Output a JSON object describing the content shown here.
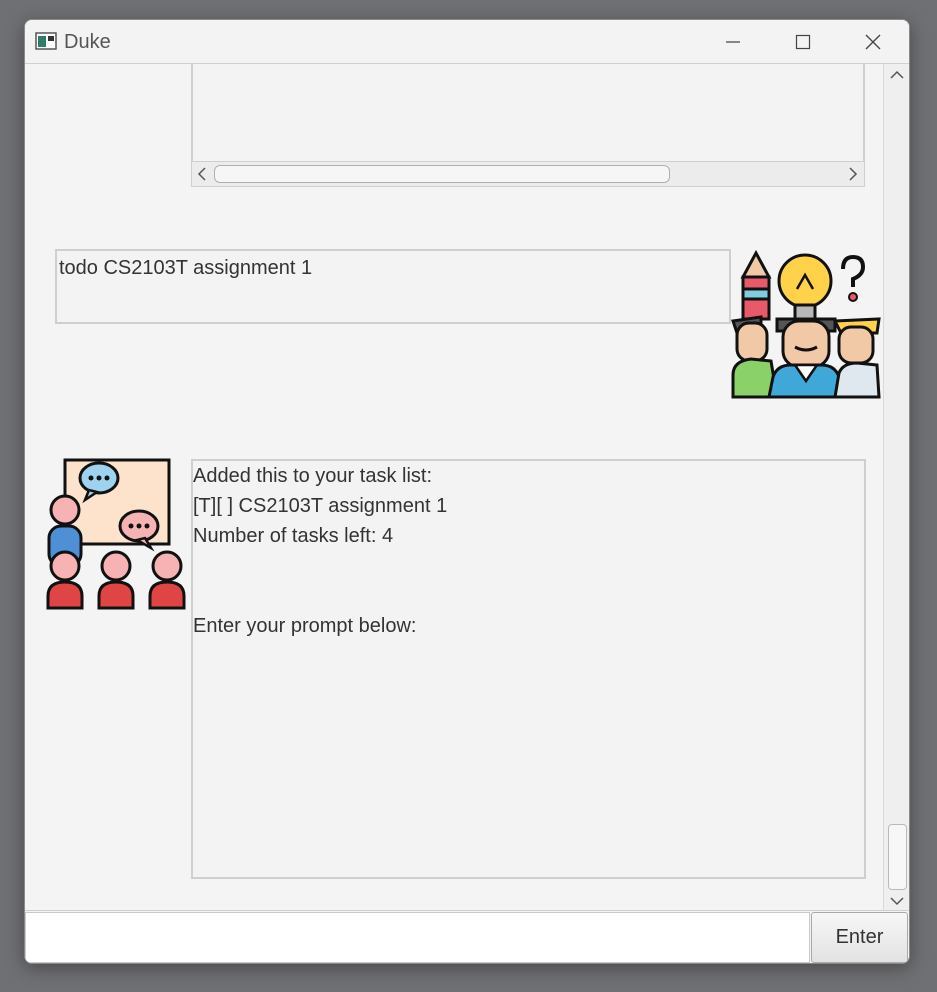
{
  "window": {
    "title": "Duke"
  },
  "dialog": [
    {
      "speaker": "user",
      "text": "todo CS2103T assignment 1"
    },
    {
      "speaker": "duke",
      "lines": [
        "Added this to your task list:",
        "[T][ ] CS2103T assignment 1",
        "Number of tasks left: 4",
        "",
        "",
        "Enter your prompt below:"
      ]
    }
  ],
  "input": {
    "value": "",
    "placeholder": ""
  },
  "enter_button": {
    "label": "Enter"
  },
  "icons": {
    "app": "app-window-icon",
    "user_avatar": "brainstorm-team-icon",
    "duke_avatar": "presentation-chat-icon"
  }
}
